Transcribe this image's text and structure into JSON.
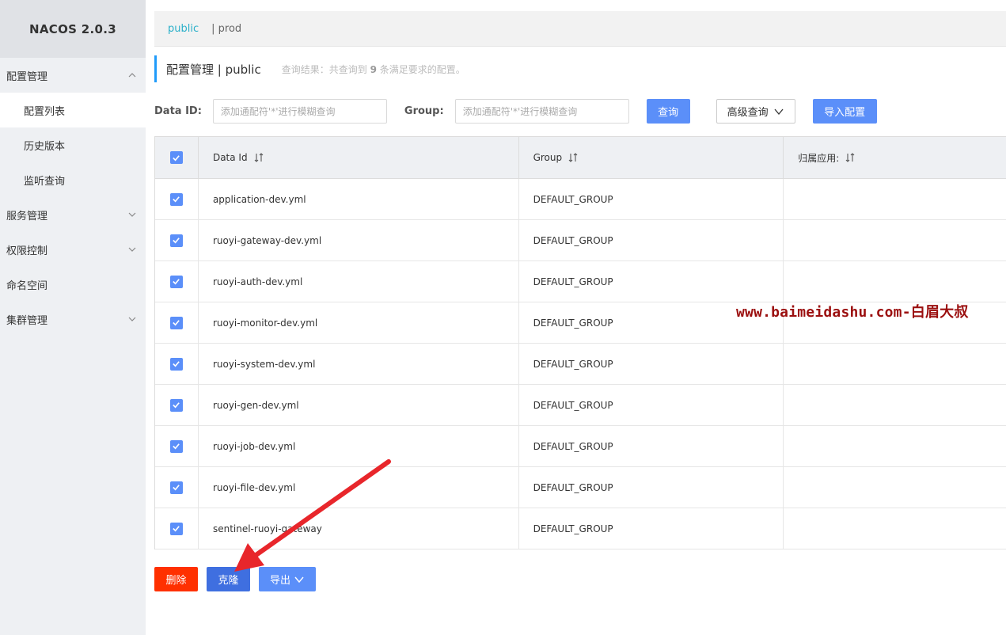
{
  "sidebar": {
    "brand": "NACOS 2.0.3",
    "items": [
      {
        "label": "配置管理"
      },
      {
        "label": "配置列表"
      },
      {
        "label": "历史版本"
      },
      {
        "label": "监听查询"
      },
      {
        "label": "服务管理"
      },
      {
        "label": "权限控制"
      },
      {
        "label": "命名空间"
      },
      {
        "label": "集群管理"
      }
    ]
  },
  "namespaces": {
    "active": "public",
    "other": "| prod"
  },
  "header": {
    "title": "配置管理 | public",
    "result_prefix": "查询结果：共查询到",
    "result_count": "9",
    "result_suffix": "条满足要求的配置。"
  },
  "search": {
    "dataid_label": "Data ID:",
    "dataid_placeholder": "添加通配符'*'进行模糊查询",
    "group_label": "Group:",
    "group_placeholder": "添加通配符'*'进行模糊查询",
    "query_button": "查询",
    "advanced_button": "高级查询",
    "import_button": "导入配置"
  },
  "table": {
    "columns": [
      "Data Id",
      "Group",
      "归属应用:"
    ],
    "rows": [
      {
        "data_id": "application-dev.yml",
        "group": "DEFAULT_GROUP",
        "app": ""
      },
      {
        "data_id": "ruoyi-gateway-dev.yml",
        "group": "DEFAULT_GROUP",
        "app": ""
      },
      {
        "data_id": "ruoyi-auth-dev.yml",
        "group": "DEFAULT_GROUP",
        "app": ""
      },
      {
        "data_id": "ruoyi-monitor-dev.yml",
        "group": "DEFAULT_GROUP",
        "app": ""
      },
      {
        "data_id": "ruoyi-system-dev.yml",
        "group": "DEFAULT_GROUP",
        "app": ""
      },
      {
        "data_id": "ruoyi-gen-dev.yml",
        "group": "DEFAULT_GROUP",
        "app": ""
      },
      {
        "data_id": "ruoyi-job-dev.yml",
        "group": "DEFAULT_GROUP",
        "app": ""
      },
      {
        "data_id": "ruoyi-file-dev.yml",
        "group": "DEFAULT_GROUP",
        "app": ""
      },
      {
        "data_id": "sentinel-ruoyi-gateway",
        "group": "DEFAULT_GROUP",
        "app": ""
      }
    ]
  },
  "actions": {
    "delete_button": "删除",
    "clone_button": "克隆",
    "export_button": "导出"
  },
  "watermark": "www.baimeidashu.com-白眉大叔",
  "colors": {
    "primary": "#5b8ff9",
    "danger": "#ff3000",
    "clone": "#3f6fe0",
    "namespace_active": "#2bb0c9",
    "title_accent": "#209bfa",
    "watermark": "#9b0f0f",
    "arrow": "#e8262b"
  }
}
